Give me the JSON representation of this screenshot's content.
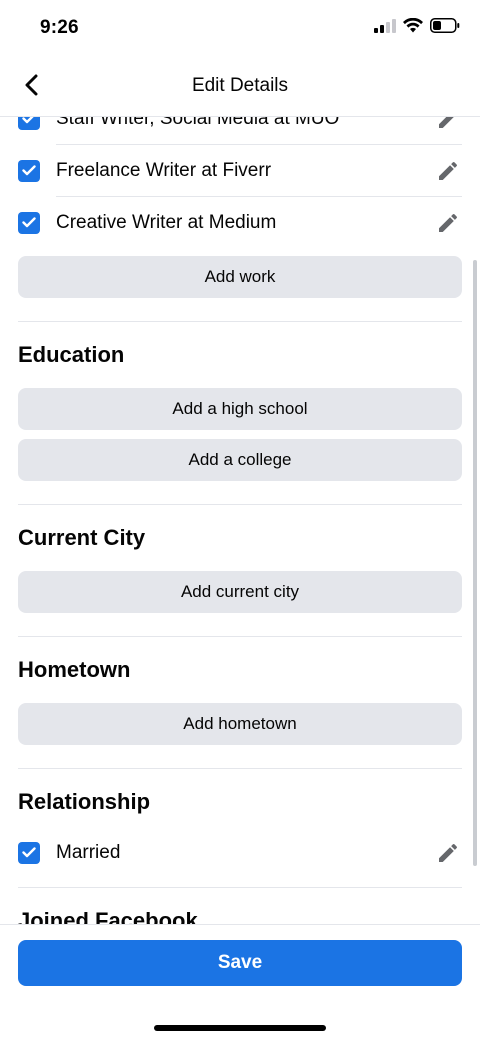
{
  "status_bar": {
    "time": "9:26"
  },
  "nav": {
    "title": "Edit Details"
  },
  "work": {
    "items": [
      {
        "label": "Staff Writer, Social Media at MUO",
        "checked": true
      },
      {
        "label": "Freelance Writer at Fiverr",
        "checked": true
      },
      {
        "label": "Creative Writer at Medium",
        "checked": true
      }
    ],
    "add_label": "Add work"
  },
  "education": {
    "title": "Education",
    "add_high_school_label": "Add a high school",
    "add_college_label": "Add a college"
  },
  "current_city": {
    "title": "Current City",
    "add_label": "Add current city"
  },
  "hometown": {
    "title": "Hometown",
    "add_label": "Add hometown"
  },
  "relationship": {
    "title": "Relationship",
    "items": [
      {
        "label": "Married",
        "checked": true
      }
    ]
  },
  "joined": {
    "title": "Joined Facebook"
  },
  "footer": {
    "save_label": "Save"
  },
  "colors": {
    "accent": "#1b74e4",
    "button_bg": "#e4e6eb",
    "divider": "#e4e6eb",
    "icon_gray": "#65676b"
  },
  "icons": {
    "back": "chevron-left-icon",
    "checkbox": "checkmark-icon",
    "edit": "pencil-icon",
    "signal": "cellular-signal-icon",
    "wifi": "wifi-icon",
    "battery": "battery-icon"
  }
}
